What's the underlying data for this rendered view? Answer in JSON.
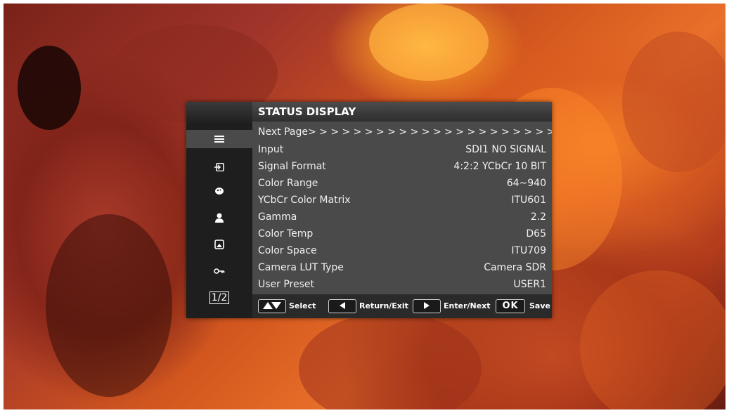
{
  "osd": {
    "title": "STATUS DISPLAY",
    "next_page": "Next Page> > > > > > > > > > > > > > > > > > > > > > >",
    "rows": [
      {
        "label": "Input",
        "value": "SDI1  NO SIGNAL"
      },
      {
        "label": "Signal Format",
        "value": "4:2:2 YCbCr 10 BIT"
      },
      {
        "label": "Color Range",
        "value": "64~940"
      },
      {
        "label": "YCbCr Color Matrix",
        "value": "ITU601"
      },
      {
        "label": "Gamma",
        "value": "2.2"
      },
      {
        "label": "Color Temp",
        "value": "D65"
      },
      {
        "label": "Color Space",
        "value": "ITU709"
      },
      {
        "label": "Camera LUT Type",
        "value": "Camera SDR"
      },
      {
        "label": "User Preset",
        "value": "USER1"
      }
    ],
    "sidebar": {
      "icons": [
        "list-icon",
        "input-icon",
        "color-palette-icon",
        "user-icon",
        "image-icon",
        "key-icon"
      ],
      "page_indicator": "1/2"
    },
    "footer": {
      "select_label": "Select",
      "return_label": "Return/Exit",
      "enter_label": "Enter/Next",
      "ok_glyph": "OK",
      "save_label": "Save"
    }
  }
}
